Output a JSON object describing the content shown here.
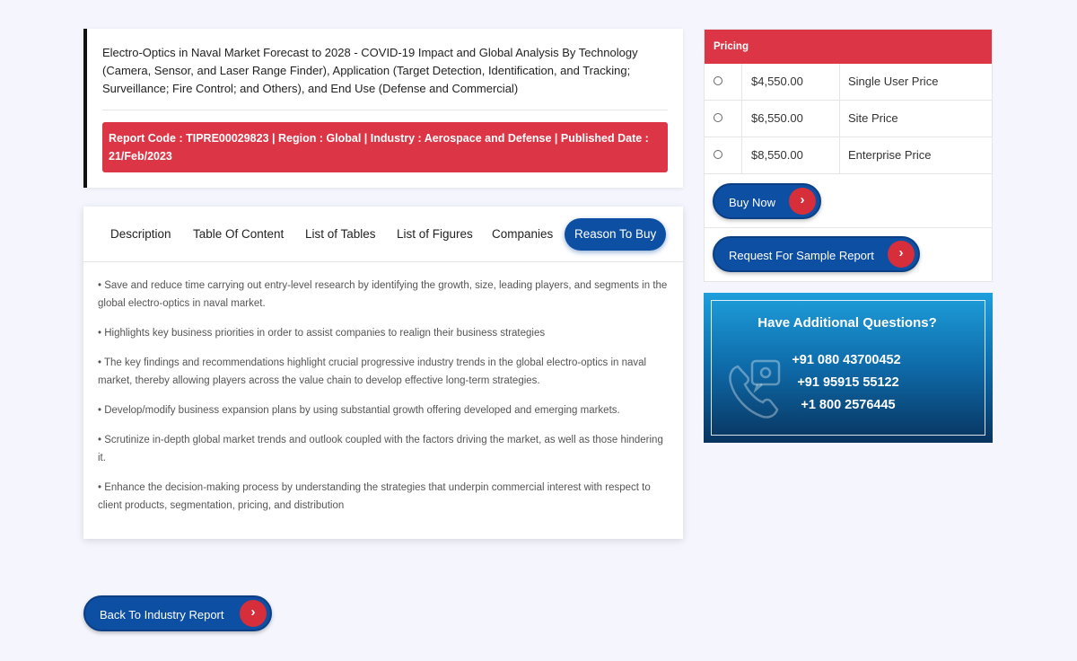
{
  "report": {
    "title": "Electro-Optics in Naval Market Forecast to 2028 - COVID-19 Impact and Global Analysis By Technology (Camera, Sensor, and Laser Range Finder), Application (Target Detection, Identification, and Tracking; Surveillance; Fire Control; and Others), and End Use (Defense and Commercial)",
    "meta": "Report Code : TIPRE00029823 | Region : Global | Industry : Aerospace and Defense | Published Date : 21/Feb/2023"
  },
  "tabs": [
    {
      "label": "Description"
    },
    {
      "label": "Table Of Content"
    },
    {
      "label": "List of Tables"
    },
    {
      "label": "List of Figures"
    },
    {
      "label": "Companies"
    },
    {
      "label": "Reason To Buy",
      "active": true
    }
  ],
  "reasons": [
    "• Save and reduce time carrying out entry-level research by identifying the growth, size, leading players, and segments in the global electro-optics in naval market.",
    "• Highlights key business priorities in order to assist companies to realign their business strategies",
    "• The key findings and recommendations highlight crucial progressive industry trends in the global electro-optics in naval market, thereby allowing players across the value chain to develop effective long-term strategies.",
    "• Develop/modify business expansion plans by using substantial growth offering developed and emerging markets.",
    "• Scrutinize in-depth global market trends and outlook coupled with the factors driving the market, as well as those hindering it.",
    "• Enhance the decision-making process by understanding the strategies that underpin commercial interest with respect to client products, segmentation, pricing, and distribution"
  ],
  "pricing": {
    "header": "Pricing",
    "options": [
      {
        "price": "$4,550.00",
        "name": "Single User Price"
      },
      {
        "price": "$6,550.00",
        "name": "Site Price"
      },
      {
        "price": "$8,550.00",
        "name": "Enterprise Price"
      }
    ],
    "buy_label": "Buy Now",
    "sample_label": "Request For Sample Report"
  },
  "questions": {
    "title": "Have Additional Questions?",
    "phones": [
      "+91 080 43700452",
      "+91 95915 55122",
      "+1 800 2576445"
    ]
  },
  "back_label": "Back To Industry Report",
  "arrow_glyph": "›",
  "colors": {
    "accent_red": "#dc3545",
    "accent_blue": "#0d4fa3"
  }
}
